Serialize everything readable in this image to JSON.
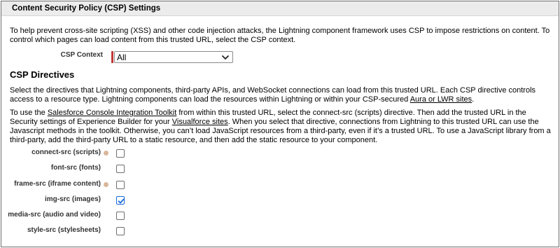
{
  "header": {
    "title": "Content Security Policy (CSP) Settings"
  },
  "intro": "To help prevent cross-site scripting (XSS) and other code injection attacks, the Lightning component framework uses CSP to impose restrictions on content. To control which pages can load content from this trusted URL, select the CSP context.",
  "csp_context": {
    "label": "CSP Context",
    "selected": "All"
  },
  "directives": {
    "title": "CSP Directives",
    "para1_a": "Select the directives that Lightning components, third-party APIs, and WebSocket connections can load from this trusted URL. Each CSP directive controls access to a resource type. Lightning components can load the resources within Lightning or within your CSP-secured ",
    "para1_link": "Aura or LWR sites",
    "para1_b": ".",
    "para2_a": "To use the ",
    "para2_link1": "Salesforce Console Integration Toolkit",
    "para2_b": " from within this trusted URL, select the connect-src (scripts) directive. Then add the trusted URL in the Security settings of Experience Builder for your ",
    "para2_link2": "Visualforce sites",
    "para2_c": ". When you select that directive, connections from Lightning to this trusted URL can use the Javascript methods in the toolkit. Otherwise, you can’t load JavaScript resources from a third-party, even if it’s a trusted URL. To use a JavaScript library from a third-party, add the third-party URL to a static resource, and then add the static resource to your component.",
    "items": [
      {
        "label": "connect-src (scripts)",
        "info": true,
        "checked": false
      },
      {
        "label": "font-src (fonts)",
        "info": false,
        "checked": false
      },
      {
        "label": "frame-src (iframe content)",
        "info": true,
        "checked": false
      },
      {
        "label": "img-src (images)",
        "info": false,
        "checked": true
      },
      {
        "label": "media-src (audio and video)",
        "info": false,
        "checked": false
      },
      {
        "label": "style-src (stylesheets)",
        "info": false,
        "checked": false
      }
    ]
  },
  "colors": {
    "required": "#c23934",
    "checkmark": "#1b6ad8",
    "header_bg": "#ececec"
  }
}
